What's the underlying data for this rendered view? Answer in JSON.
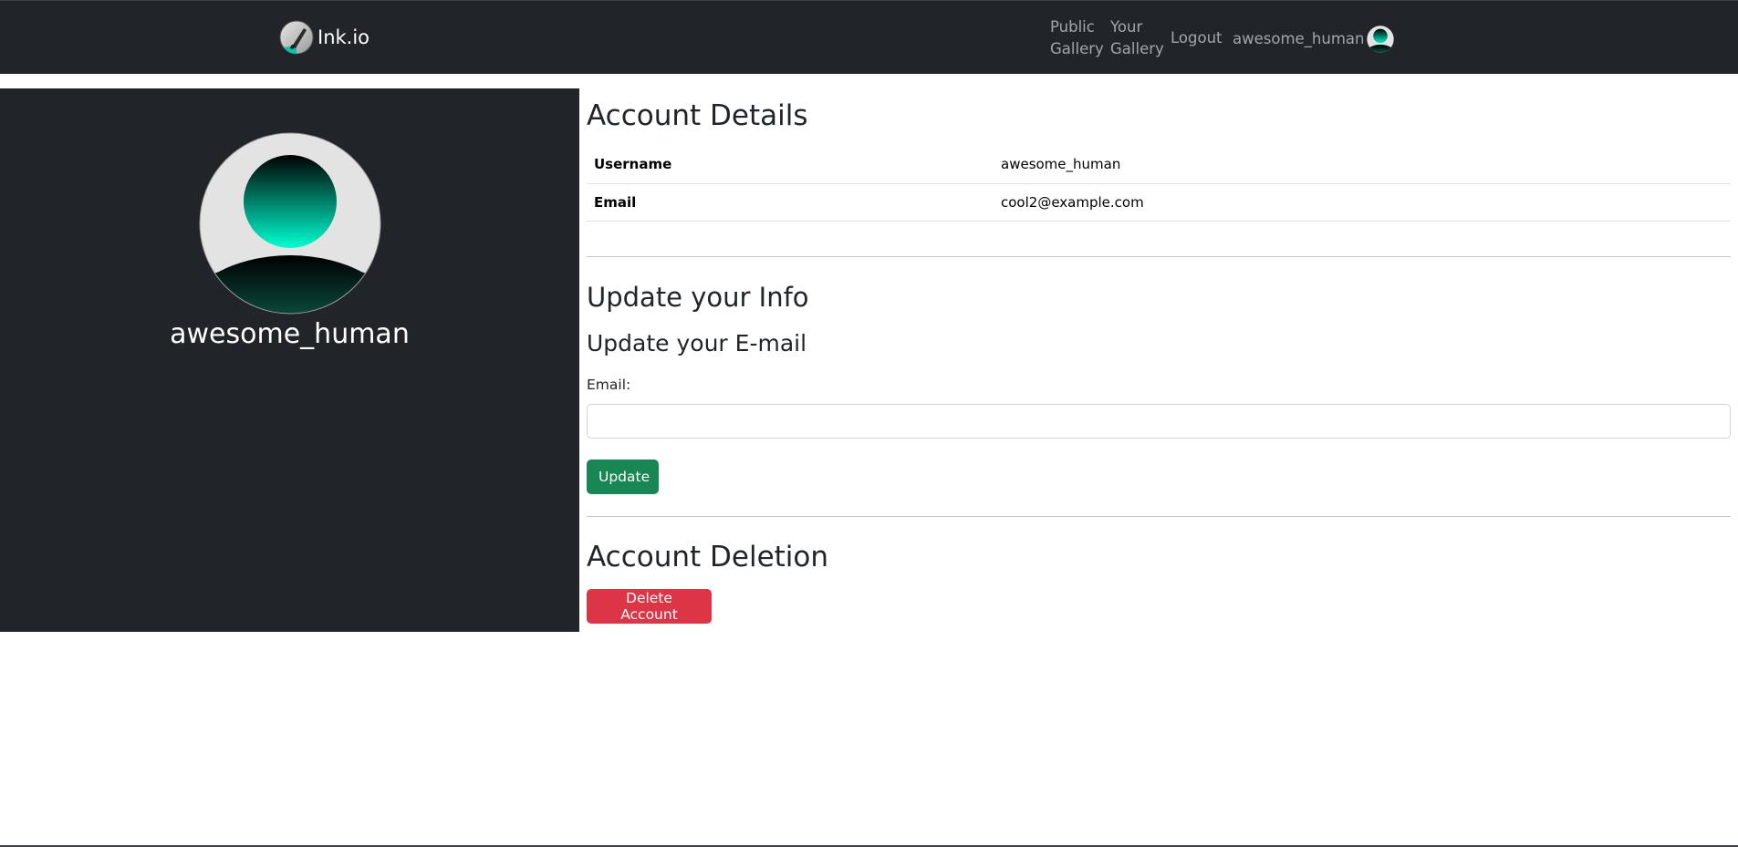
{
  "navbar": {
    "brand": "Ink.io",
    "links": {
      "public_gallery": [
        "Public",
        "Gallery"
      ],
      "your_gallery": [
        "Your",
        "Gallery"
      ],
      "logout": "Logout",
      "username": "awesome_human"
    }
  },
  "sidebar": {
    "username": "awesome_human"
  },
  "account_details": {
    "heading": "Account Details",
    "rows": [
      {
        "key": "Username",
        "value": "awesome_human"
      },
      {
        "key": "Email",
        "value": "cool2@example.com"
      }
    ]
  },
  "update": {
    "heading": "Update your Info",
    "email_heading": "Update your E-mail",
    "email_label": "Email:",
    "email_value": "",
    "button": "Update"
  },
  "deletion": {
    "heading": "Account Deletion",
    "button": "Delete Account"
  },
  "colors": {
    "navbar_bg": "#212529",
    "sidebar_bg": "#212529",
    "update_button": "#198754",
    "delete_button": "#dc3545",
    "avatar_accent": "#00e5c0"
  },
  "icons": {
    "brand_logo": "ink-brush-logo-icon",
    "user_avatar": "user-avatar-icon"
  }
}
